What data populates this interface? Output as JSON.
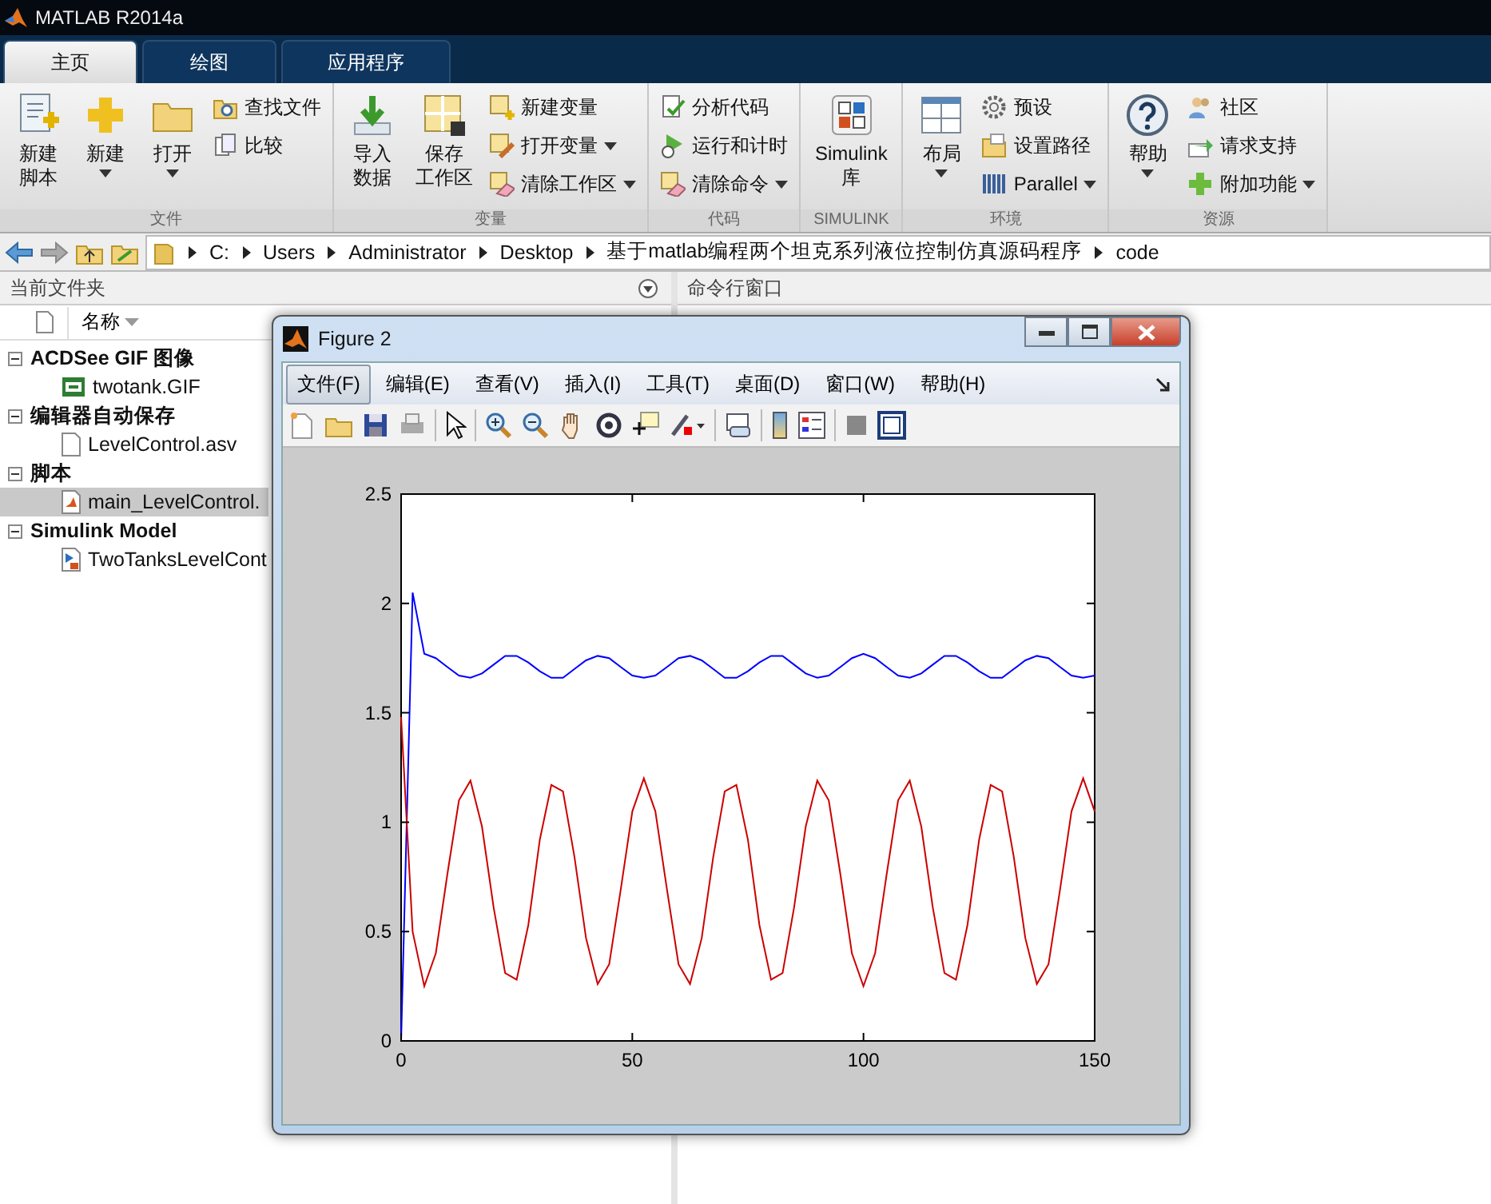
{
  "window": {
    "title": "MATLAB R2014a"
  },
  "tabs": [
    {
      "label": "主页",
      "selected": true
    },
    {
      "label": "绘图",
      "selected": false
    },
    {
      "label": "应用程序",
      "selected": false
    }
  ],
  "ribbon": [
    {
      "label": "文件",
      "items": [
        {
          "kind": "large",
          "lines": [
            "新建",
            "脚本"
          ],
          "dropdown": false
        },
        {
          "kind": "large",
          "lines": [
            "新建"
          ],
          "dropdown": true
        },
        {
          "kind": "large",
          "lines": [
            "打开"
          ],
          "dropdown": true
        },
        {
          "kind": "stack",
          "entries": [
            {
              "label": "查找文件",
              "dropdown": false
            },
            {
              "label": "比较",
              "dropdown": false
            }
          ]
        }
      ]
    },
    {
      "label": "变量",
      "items": [
        {
          "kind": "large",
          "lines": [
            "导入",
            "数据"
          ],
          "dropdown": false
        },
        {
          "kind": "large",
          "lines": [
            "保存",
            "工作区"
          ],
          "dropdown": false
        },
        {
          "kind": "stack",
          "entries": [
            {
              "label": "新建变量",
              "dropdown": false
            },
            {
              "label": "打开变量",
              "dropdown": true
            },
            {
              "label": "清除工作区",
              "dropdown": true
            }
          ]
        }
      ]
    },
    {
      "label": "代码",
      "items": [
        {
          "kind": "stack",
          "entries": [
            {
              "label": "分析代码",
              "dropdown": false
            },
            {
              "label": "运行和计时",
              "dropdown": false
            },
            {
              "label": "清除命令",
              "dropdown": true
            }
          ]
        }
      ]
    },
    {
      "label": "SIMULINK",
      "items": [
        {
          "kind": "large",
          "lines": [
            "Simulink",
            "库"
          ],
          "dropdown": false
        }
      ]
    },
    {
      "label": "环境",
      "items": [
        {
          "kind": "large",
          "lines": [
            "布局"
          ],
          "dropdown": true
        },
        {
          "kind": "stack",
          "entries": [
            {
              "label": "预设",
              "dropdown": false
            },
            {
              "label": "设置路径",
              "dropdown": false
            },
            {
              "label": "Parallel",
              "dropdown": true
            }
          ]
        }
      ]
    },
    {
      "label": "资源",
      "items": [
        {
          "kind": "large",
          "lines": [
            "帮助"
          ],
          "dropdown": true
        },
        {
          "kind": "stack",
          "entries": [
            {
              "label": "社区",
              "dropdown": false
            },
            {
              "label": "请求支持",
              "dropdown": false
            },
            {
              "label": "附加功能",
              "dropdown": true
            }
          ]
        }
      ]
    }
  ],
  "address_bar": {
    "segments": [
      "C:",
      "Users",
      "Administrator",
      "Desktop",
      "基于matlab编程两个坦克系列液位控制仿真源码程序",
      "code"
    ]
  },
  "current_folder": {
    "title": "当前文件夹",
    "column": "名称",
    "groups": [
      {
        "label": "ACDSee GIF 图像",
        "expanded": true,
        "children": [
          {
            "kind": "image",
            "name": "twotank.GIF",
            "selected": false
          }
        ]
      },
      {
        "label": "编辑器自动保存",
        "expanded": true,
        "children": [
          {
            "kind": "file",
            "name": "LevelControl.asv",
            "selected": false
          }
        ]
      },
      {
        "label": "脚本",
        "expanded": true,
        "children": [
          {
            "kind": "script",
            "name": "main_LevelControl.",
            "selected": true
          }
        ]
      },
      {
        "label": "Simulink Model",
        "expanded": true,
        "children": [
          {
            "kind": "model",
            "name": "TwoTanksLevelCont",
            "selected": false
          }
        ]
      }
    ]
  },
  "command_window": {
    "title": "命令行窗口"
  },
  "figure": {
    "title": "Figure 2",
    "menu": [
      {
        "label": "文件(F)",
        "selected": true
      },
      {
        "label": "编辑(E)",
        "selected": false
      },
      {
        "label": "查看(V)",
        "selected": false
      },
      {
        "label": "插入(I)",
        "selected": false
      },
      {
        "label": "工具(T)",
        "selected": false
      },
      {
        "label": "桌面(D)",
        "selected": false
      },
      {
        "label": "窗口(W)",
        "selected": false
      },
      {
        "label": "帮助(H)",
        "selected": false
      }
    ],
    "chart_data": {
      "type": "line",
      "xlim": [
        0,
        150
      ],
      "ylim": [
        0,
        2.5
      ],
      "xticks": [
        0,
        50,
        100,
        150
      ],
      "yticks": [
        0,
        0.5,
        1,
        1.5,
        2,
        2.5
      ],
      "x": [
        0,
        2.5,
        5,
        7.5,
        10,
        12.5,
        15,
        17.5,
        20,
        22.5,
        25,
        27.5,
        30,
        32.5,
        35,
        37.5,
        40,
        42.5,
        45,
        47.5,
        50,
        52.5,
        55,
        57.5,
        60,
        62.5,
        65,
        67.5,
        70,
        72.5,
        75,
        77.5,
        80,
        82.5,
        85,
        87.5,
        90,
        92.5,
        95,
        97.5,
        100,
        102.5,
        105,
        107.5,
        110,
        112.5,
        115,
        117.5,
        120,
        122.5,
        125,
        127.5,
        130,
        132.5,
        135,
        137.5,
        140,
        142.5,
        145,
        147.5,
        150
      ],
      "series": [
        {
          "color": "#0000ff",
          "values": [
            0,
            2.05,
            1.77,
            1.75,
            1.71,
            1.67,
            1.66,
            1.68,
            1.72,
            1.76,
            1.76,
            1.73,
            1.69,
            1.66,
            1.66,
            1.7,
            1.74,
            1.76,
            1.75,
            1.71,
            1.67,
            1.66,
            1.67,
            1.71,
            1.75,
            1.76,
            1.74,
            1.7,
            1.66,
            1.66,
            1.69,
            1.73,
            1.76,
            1.76,
            1.72,
            1.68,
            1.66,
            1.67,
            1.71,
            1.75,
            1.77,
            1.75,
            1.71,
            1.67,
            1.66,
            1.68,
            1.72,
            1.76,
            1.76,
            1.73,
            1.69,
            1.66,
            1.66,
            1.7,
            1.74,
            1.76,
            1.75,
            1.71,
            1.67,
            1.66,
            1.67
          ]
        },
        {
          "color": "#cc0000",
          "values": [
            1.48,
            0.5,
            0.25,
            0.4,
            0.76,
            1.1,
            1.19,
            0.98,
            0.61,
            0.31,
            0.28,
            0.53,
            0.92,
            1.17,
            1.14,
            0.84,
            0.47,
            0.26,
            0.35,
            0.69,
            1.05,
            1.2,
            1.05,
            0.69,
            0.35,
            0.26,
            0.47,
            0.84,
            1.14,
            1.17,
            0.92,
            0.53,
            0.28,
            0.31,
            0.61,
            0.98,
            1.19,
            1.1,
            0.76,
            0.4,
            0.25,
            0.4,
            0.76,
            1.1,
            1.19,
            0.98,
            0.61,
            0.31,
            0.28,
            0.53,
            0.92,
            1.17,
            1.14,
            0.84,
            0.47,
            0.26,
            0.35,
            0.69,
            1.05,
            1.2,
            1.05
          ]
        }
      ]
    }
  }
}
